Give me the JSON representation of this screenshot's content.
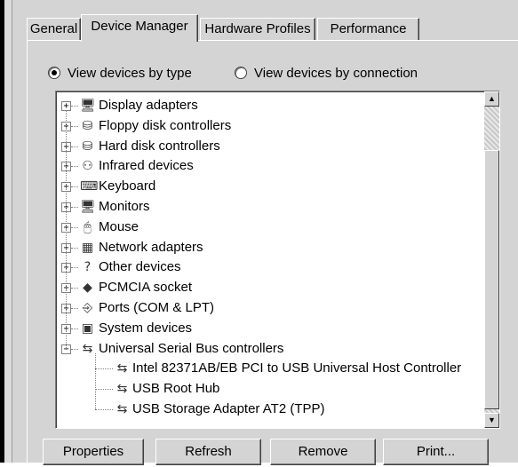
{
  "tabs": [
    "General",
    "Device Manager",
    "Hardware Profiles",
    "Performance"
  ],
  "view": {
    "by_type": "View devices by type",
    "by_connection": "View devices by connection",
    "selected": "by_type"
  },
  "devices": [
    {
      "label": "Display adapters",
      "icon": "display-adapter-icon",
      "expanded": false
    },
    {
      "label": "Floppy disk controllers",
      "icon": "floppy-controller-icon",
      "expanded": false
    },
    {
      "label": "Hard disk controllers",
      "icon": "hard-disk-controller-icon",
      "expanded": false
    },
    {
      "label": "Infrared devices",
      "icon": "infrared-icon",
      "expanded": false
    },
    {
      "label": "Keyboard",
      "icon": "keyboard-icon",
      "expanded": false
    },
    {
      "label": "Monitors",
      "icon": "monitor-icon",
      "expanded": false
    },
    {
      "label": "Mouse",
      "icon": "mouse-icon",
      "expanded": false
    },
    {
      "label": "Network adapters",
      "icon": "network-adapter-icon",
      "expanded": false
    },
    {
      "label": "Other devices",
      "icon": "question-icon",
      "expanded": false
    },
    {
      "label": "PCMCIA socket",
      "icon": "pcmcia-icon",
      "expanded": false
    },
    {
      "label": "Ports (COM & LPT)",
      "icon": "port-icon",
      "expanded": false
    },
    {
      "label": "System devices",
      "icon": "system-icon",
      "expanded": false
    },
    {
      "label": "Universal Serial Bus controllers",
      "icon": "usb-icon",
      "expanded": true
    }
  ],
  "usb_children": [
    {
      "label": "Intel 82371AB/EB PCI to USB Universal Host Controller",
      "icon": "usb-icon"
    },
    {
      "label": "USB Root Hub",
      "icon": "usb-icon"
    },
    {
      "label": "USB Storage Adapter AT2 (TPP)",
      "icon": "usb-icon"
    }
  ],
  "buttons": {
    "properties": "Properties",
    "refresh": "Refresh",
    "remove": "Remove",
    "print": "Print..."
  }
}
